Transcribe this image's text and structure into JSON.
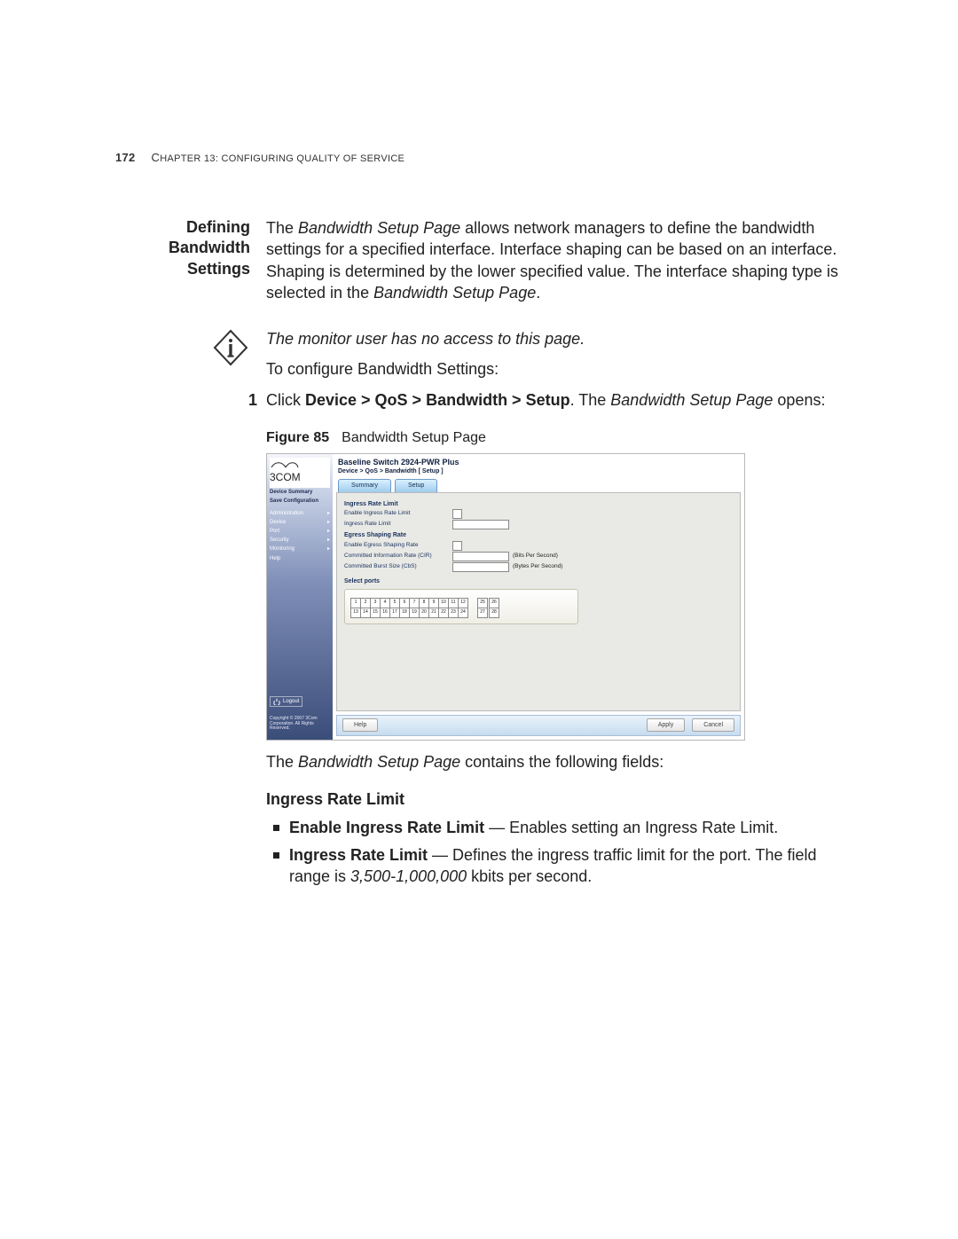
{
  "header": {
    "page_number": "172",
    "chapter_prefix": "C",
    "chapter_rest": "HAPTER 13: C",
    "chapter_rest2": "ONFIGURING Q",
    "chapter_rest3": "UALITY OF S",
    "chapter_rest4": "ERVICE"
  },
  "side_heading": "Defining Bandwidth Settings",
  "intro": {
    "p1a": "The ",
    "p1b": "Bandwidth Setup Page",
    "p1c": " allows network managers to define the bandwidth settings for a specified interface. Interface shaping can be based on an interface. Shaping is determined by the lower specified value. The interface shaping type is selected in the ",
    "p1d": "Bandwidth Setup Page",
    "p1e": "."
  },
  "note": "The monitor user has no access to this page.",
  "lead": "To configure Bandwidth Settings:",
  "step1": {
    "num": "1",
    "a": "Click ",
    "b": "Device > QoS > Bandwidth > Setup",
    "c": ". The ",
    "d": "Bandwidth Setup Page",
    "e": " opens:"
  },
  "figure": {
    "label": "Figure 85",
    "caption": "Bandwidth Setup Page"
  },
  "shot": {
    "logo_text": "3COM",
    "device_title": "Baseline Switch 2924-PWR Plus",
    "breadcrumb": "Device > QoS > Bandwidth [ Setup ]",
    "tabs": [
      "Summary",
      "Setup"
    ],
    "nav_top": [
      "Device Summary",
      "Save Configuration"
    ],
    "nav": [
      "Administration",
      "Device",
      "Port",
      "Security",
      "Monitoring",
      "Help"
    ],
    "legend": "Logout",
    "copyright": "Copyright © 2007 3Com Corporation. All Rights Reserved.",
    "groups": {
      "g1": "Ingress Rate Limit",
      "g1_r1": "Enable Ingress Rate Limit",
      "g1_r2": "Ingress Rate Limit",
      "g2": "Egress Shaping Rate",
      "g2_r1": "Enable Egress Shaping Rate",
      "g2_r2": "Committed Information Rate (CIR)",
      "g2_r2_unit": "(Bits Per Second)",
      "g2_r3": "Committed Burst Size (CbS)",
      "g2_r3_unit": "(Bytes Per Second)"
    },
    "select_ports": "Select ports",
    "buttons": {
      "help": "Help",
      "apply": "Apply",
      "cancel": "Cancel"
    }
  },
  "after_fig": {
    "a": "The ",
    "b": "Bandwidth Setup Page",
    "c": " contains the following fields:"
  },
  "section_heading": "Ingress Rate Limit",
  "bullets": {
    "b1a": "Enable Ingress Rate Limit",
    "b1b": " — Enables setting an Ingress Rate Limit.",
    "b2a": "Ingress Rate Limit",
    "b2b": " — Defines the ingress traffic limit for the port. The field range is ",
    "b2c": "3,500-1,000,000",
    "b2d": " kbits per second."
  }
}
